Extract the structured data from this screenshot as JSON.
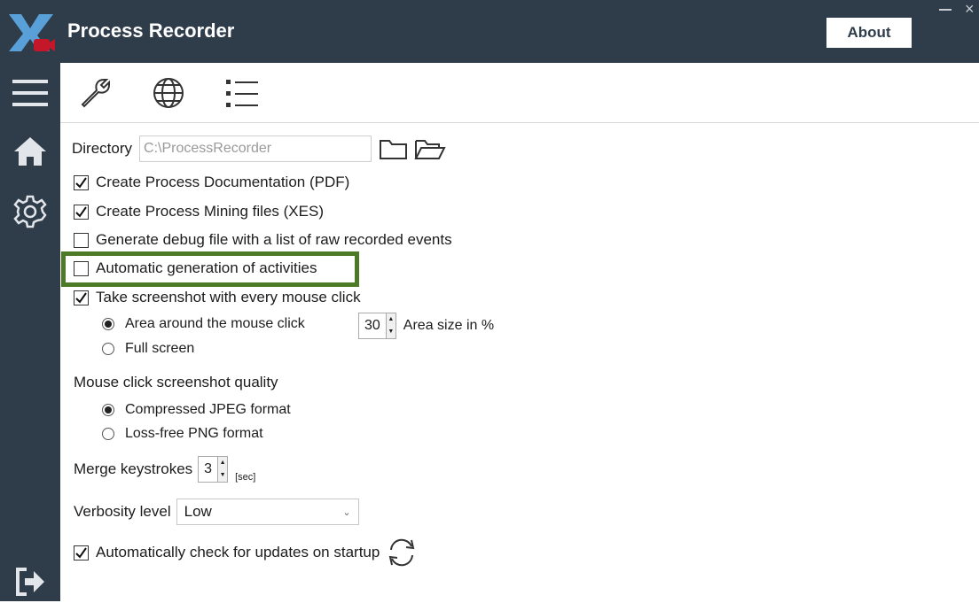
{
  "app": {
    "title": "Process Recorder",
    "about_label": "About"
  },
  "window": {
    "minimize": "–",
    "close": "×"
  },
  "sidebar": [
    "menu-icon",
    "home-icon",
    "gear-icon",
    "logout-icon"
  ],
  "toolbar": [
    "wrench-icon",
    "globe-icon",
    "list-icon"
  ],
  "settings": {
    "directory": {
      "label": "Directory",
      "value": "C:\\ProcessRecorder"
    },
    "create_pdf": {
      "label": "Create Process Documentation (PDF)",
      "checked": true
    },
    "create_xes": {
      "label": "Create Process Mining files (XES)",
      "checked": true
    },
    "debug_file": {
      "label": "Generate debug file with a list of raw recorded events",
      "checked": false
    },
    "auto_activities": {
      "label": "Automatic generation of activities",
      "checked": false
    },
    "screenshot": {
      "label": "Take screenshot with every mouse click",
      "checked": true
    },
    "area_mouse": {
      "label": "Area around the mouse click",
      "selected": true
    },
    "area_size": {
      "value": "30",
      "label": "Area size in %"
    },
    "full_screen": {
      "label": "Full screen",
      "selected": false
    },
    "quality_label": "Mouse click screenshot quality",
    "jpeg": {
      "label": "Compressed JPEG format",
      "selected": true
    },
    "png": {
      "label": "Loss-free PNG format",
      "selected": false
    },
    "merge": {
      "label": "Merge keystrokes",
      "value": "3",
      "unit": "[sec]"
    },
    "verbosity": {
      "label": "Verbosity level",
      "value": "Low"
    },
    "updates": {
      "label": "Automatically check for updates on startup",
      "checked": true
    }
  },
  "colors": {
    "sidebar": "#2f3c49",
    "highlight": "#4d7a27"
  }
}
